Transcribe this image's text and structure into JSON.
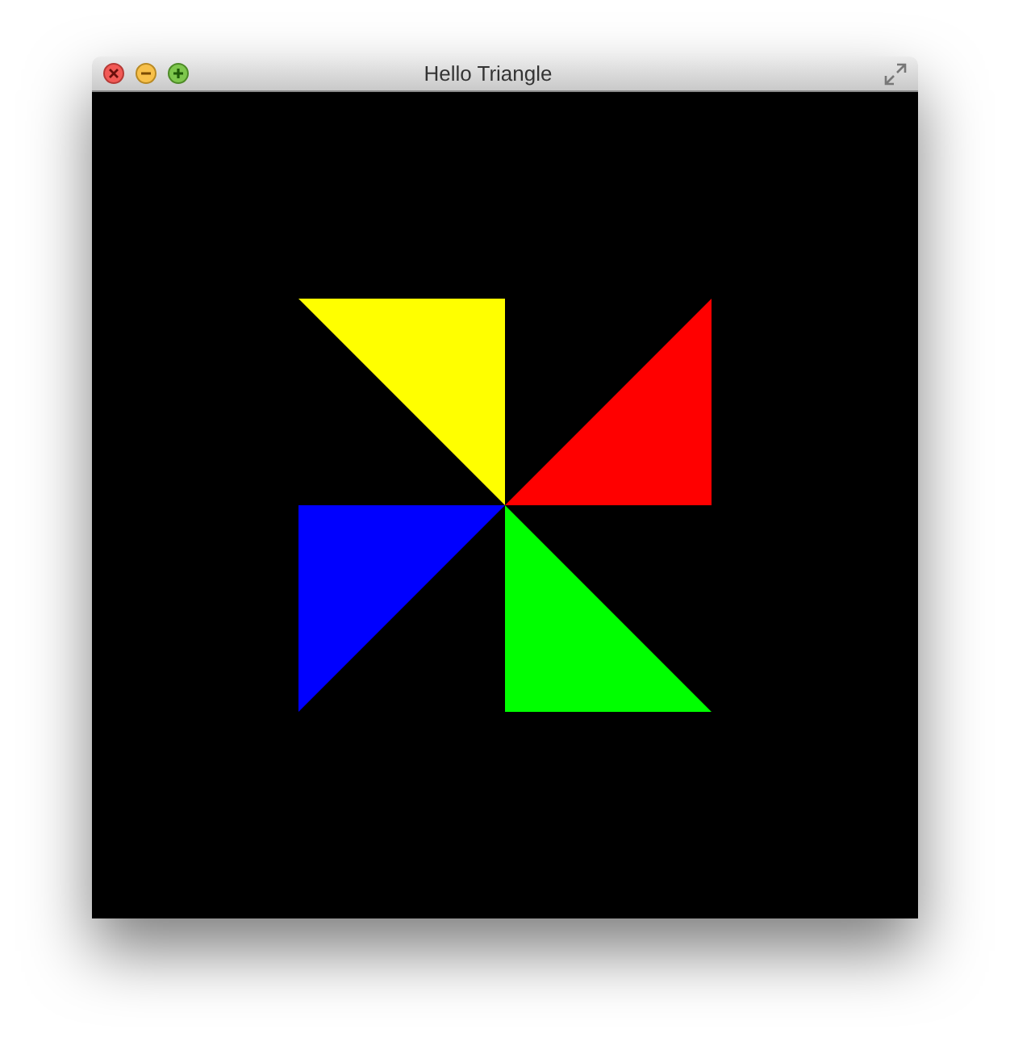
{
  "window": {
    "title": "Hello Triangle"
  },
  "triangles": [
    {
      "color": "#ffff00"
    },
    {
      "color": "#ff0000"
    },
    {
      "color": "#0000ff"
    },
    {
      "color": "#00ff00"
    }
  ]
}
